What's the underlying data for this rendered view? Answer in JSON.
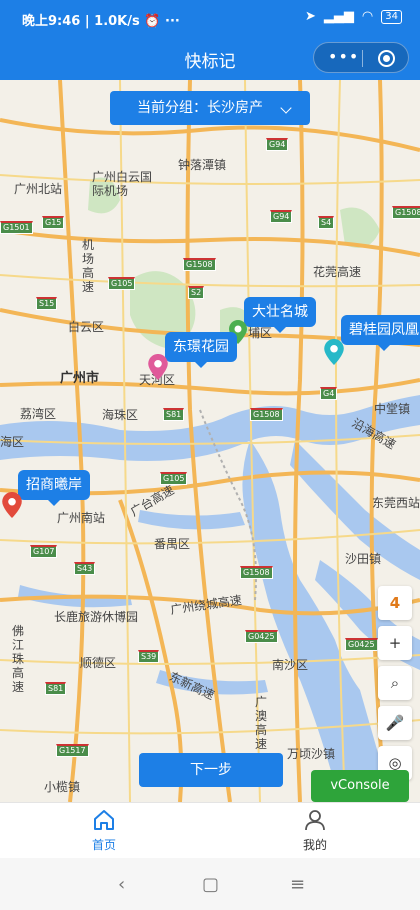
{
  "status_bar": {
    "time": "晚上9:46",
    "speed": "1.0K/s",
    "more": "···",
    "battery": "34"
  },
  "titlebar": {
    "title": "快标记",
    "capsule_more": "•••"
  },
  "group_selector": {
    "label": "当前分组：长沙房产"
  },
  "markers": [
    {
      "label": "大壮名城",
      "color": "#4caf50"
    },
    {
      "label": "东璟花园",
      "color": "#e05a9a"
    },
    {
      "label": "碧桂园凤凰",
      "color": "#26b8c8"
    },
    {
      "label": "招商曦岸",
      "color": "#e24a3b"
    }
  ],
  "map_labels": {
    "zhongluotan": "钟落潭镇",
    "guangzhou_north": "广州北站",
    "baiyun_airport": "广州白云国际机场",
    "baiyun_district": "白云区",
    "guangzhou_city": "广州市",
    "tianhe": "天河区",
    "huangpu": "埔区",
    "liwan": "荔湾区",
    "haizhu": "海珠区",
    "hai_edge": "海区",
    "panyu": "番禺区",
    "guangzhou_south": "广州南站",
    "changlong": "长鹿旅游休博园",
    "shunde": "顺德区",
    "nansha": "南沙区",
    "wanqingsha": "万顷沙镇",
    "xiaolan": "小榄镇",
    "shatian": "沙田镇",
    "zhongtang": "中堂镇",
    "dongguan_west": "东莞西站",
    "airport_road": "机场高速",
    "huaguan_road": "花莞高速",
    "guangtai_road": "广台高速",
    "ring_road": "广州绕城高速",
    "dongxin_road": "东新高速",
    "foshan_jiangzhu": "佛江珠高速",
    "guangao": "广澳高速",
    "yanjiang": "沿海高速"
  },
  "highway_shields": [
    "G94",
    "G1508",
    "G105",
    "G15",
    "G1508",
    "S81",
    "G1501",
    "S2",
    "G4",
    "S15",
    "G107",
    "G105",
    "S43",
    "G1508",
    "G0425",
    "S39",
    "G94",
    "G1517",
    "G1508",
    "S4",
    "G0425",
    "S81"
  ],
  "side_tools": {
    "count": "4",
    "zoom_in": "+",
    "search": "⌕",
    "voice": "🎤",
    "locate": "◎"
  },
  "actions": {
    "next": "下一步",
    "vconsole": "vConsole"
  },
  "tabbar": {
    "home": "首页",
    "mine": "我的"
  },
  "navbar": {
    "back": "‹",
    "home": "▢",
    "menu": "≡"
  },
  "colors": {
    "brand": "#1d7fe6",
    "vconsole": "#2ea43a"
  }
}
